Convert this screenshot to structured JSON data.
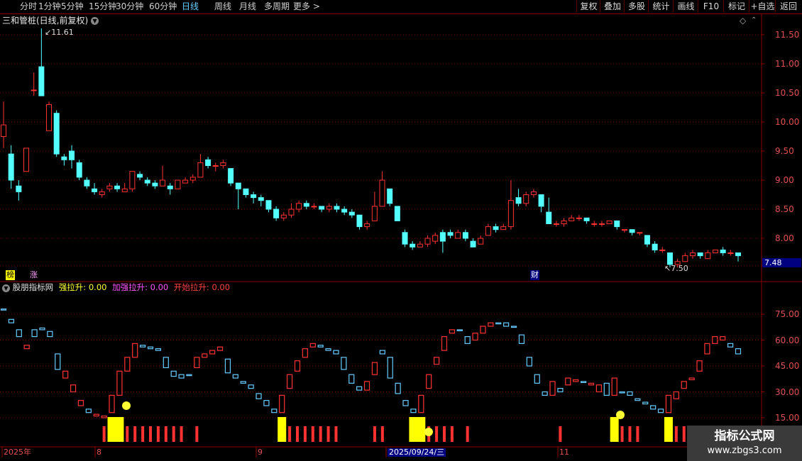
{
  "toolbar": {
    "left_items": [
      "分时",
      "1分钟",
      "5分钟",
      "15分钟",
      "30分钟",
      "60分钟",
      "日线",
      "周线",
      "月线",
      "多周期",
      "更多 >"
    ],
    "active_item": "日线",
    "right_buttons": [
      "复权",
      "叠加",
      "多股",
      "统计",
      "画线",
      "F10",
      "标记",
      "+自选",
      "返回"
    ]
  },
  "main_panel": {
    "title": "三和管桩(日线,前复权)",
    "high_label": "11.61",
    "low_label": "7.50",
    "price_tag": "7.48",
    "markers": {
      "bang": "榜",
      "zhang": "涨",
      "cai": "财"
    },
    "y_ticks": [
      "11.50",
      "11.00",
      "10.50",
      "10.00",
      "9.50",
      "9.00",
      "8.50",
      "8.00"
    ]
  },
  "indicator_panel": {
    "name": "股朋指标网",
    "line1_label": "强拉升:",
    "line1_value": "0.00",
    "line2_label": "加强拉升:",
    "line2_value": "0.00",
    "line3_label": "开始拉升:",
    "line3_value": "0.00",
    "y_ticks": [
      "75.00",
      "60.00",
      "45.00",
      "30.00",
      "15.00"
    ]
  },
  "x_axis": {
    "labels": [
      "2025年",
      "8",
      "9",
      "2025/09/24/三",
      "11"
    ]
  },
  "watermark": {
    "title": "指标公式网",
    "url": "www.zbgs3.com"
  },
  "colors": {
    "up": "#ff3232",
    "down": "#54ffff",
    "grid": "#8b0000",
    "yellow": "#ffff00",
    "magenta": "#ff55ff",
    "blue_hl": "#000080"
  },
  "chart_data": {
    "type": "candlestick",
    "candles": [
      [
        9.75,
        9.95,
        10.35,
        9.55
      ],
      [
        9.45,
        9.0,
        9.6,
        8.85
      ],
      [
        8.9,
        8.8,
        9.0,
        8.65
      ],
      [
        9.15,
        9.55,
        9.55,
        9.15
      ],
      [
        10.55,
        10.55,
        10.85,
        10.45
      ],
      [
        10.95,
        10.45,
        11.61,
        10.45
      ],
      [
        9.85,
        10.3,
        10.35,
        9.85
      ],
      [
        10.15,
        9.45,
        10.2,
        9.4
      ],
      [
        9.4,
        9.35,
        9.45,
        9.25
      ],
      [
        9.5,
        9.35,
        9.6,
        9.2
      ],
      [
        9.3,
        9.05,
        9.35,
        9.0
      ],
      [
        9.0,
        8.9,
        9.05,
        8.85
      ],
      [
        8.85,
        8.8,
        8.95,
        8.75
      ],
      [
        8.75,
        8.8,
        8.85,
        8.7
      ],
      [
        8.85,
        8.9,
        8.95,
        8.8
      ],
      [
        8.9,
        8.85,
        8.95,
        8.8
      ],
      [
        8.8,
        8.85,
        8.95,
        8.8
      ],
      [
        8.85,
        9.15,
        9.15,
        8.8
      ],
      [
        9.1,
        9.05,
        9.15,
        9.0
      ],
      [
        9.0,
        8.95,
        9.05,
        8.9
      ],
      [
        8.95,
        8.9,
        9.0,
        8.85
      ],
      [
        8.9,
        9.0,
        9.25,
        8.9
      ],
      [
        8.9,
        8.85,
        8.95,
        8.75
      ],
      [
        8.85,
        9.0,
        9.0,
        8.85
      ],
      [
        8.95,
        9.0,
        9.05,
        8.95
      ],
      [
        9.0,
        9.05,
        9.1,
        8.95
      ],
      [
        9.05,
        9.3,
        9.45,
        9.05
      ],
      [
        9.35,
        9.25,
        9.4,
        9.2
      ],
      [
        9.25,
        9.25,
        9.3,
        9.15
      ],
      [
        9.25,
        9.3,
        9.35,
        9.2
      ],
      [
        9.2,
        8.95,
        9.2,
        8.9
      ],
      [
        8.95,
        8.85,
        8.95,
        8.5
      ],
      [
        8.85,
        8.75,
        8.85,
        8.7
      ],
      [
        8.75,
        8.7,
        8.8,
        8.6
      ],
      [
        8.7,
        8.65,
        8.75,
        8.55
      ],
      [
        8.65,
        8.5,
        8.65,
        8.45
      ],
      [
        8.5,
        8.35,
        8.55,
        8.3
      ],
      [
        8.35,
        8.4,
        8.45,
        8.3
      ],
      [
        8.4,
        8.5,
        8.6,
        8.35
      ],
      [
        8.5,
        8.6,
        8.65,
        8.45
      ],
      [
        8.6,
        8.55,
        8.65,
        8.5
      ],
      [
        8.55,
        8.55,
        8.6,
        8.5
      ],
      [
        8.55,
        8.5,
        8.55,
        8.45
      ],
      [
        8.5,
        8.55,
        8.6,
        8.45
      ],
      [
        8.55,
        8.5,
        8.6,
        8.45
      ],
      [
        8.5,
        8.45,
        8.55,
        8.4
      ],
      [
        8.45,
        8.4,
        8.5,
        8.35
      ],
      [
        8.4,
        8.2,
        8.4,
        8.15
      ],
      [
        8.2,
        8.25,
        8.3,
        8.15
      ],
      [
        8.3,
        8.55,
        8.8,
        8.3
      ],
      [
        8.55,
        9.0,
        9.15,
        8.55
      ],
      [
        8.85,
        8.6,
        8.85,
        8.55
      ],
      [
        8.55,
        8.3,
        8.55,
        8.3
      ],
      [
        8.1,
        7.9,
        8.15,
        7.85
      ],
      [
        7.9,
        7.85,
        7.95,
        7.8
      ],
      [
        7.85,
        7.9,
        7.95,
        7.85
      ],
      [
        7.9,
        8.0,
        8.05,
        7.85
      ],
      [
        7.95,
        8.05,
        8.1,
        7.9
      ],
      [
        8.1,
        7.95,
        8.15,
        7.75
      ],
      [
        8.1,
        8.05,
        8.15,
        8.0
      ],
      [
        8.0,
        8.1,
        8.15,
        8.0
      ],
      [
        8.1,
        8.0,
        8.15,
        7.95
      ],
      [
        7.95,
        7.85,
        8.0,
        7.85
      ],
      [
        7.9,
        8.0,
        8.05,
        7.9
      ],
      [
        8.05,
        8.2,
        8.25,
        8.05
      ],
      [
        8.2,
        8.15,
        8.25,
        8.1
      ],
      [
        8.15,
        8.2,
        8.25,
        8.15
      ],
      [
        8.2,
        8.65,
        9.0,
        8.15
      ],
      [
        8.7,
        8.6,
        8.85,
        8.55
      ],
      [
        8.6,
        8.75,
        8.8,
        8.55
      ],
      [
        8.75,
        8.8,
        8.85,
        8.7
      ],
      [
        8.75,
        8.55,
        8.75,
        8.45
      ],
      [
        8.45,
        8.25,
        8.7,
        8.25
      ],
      [
        8.25,
        8.25,
        8.3,
        8.2
      ],
      [
        8.25,
        8.3,
        8.35,
        8.2
      ],
      [
        8.3,
        8.35,
        8.4,
        8.3
      ],
      [
        8.35,
        8.35,
        8.4,
        8.3
      ],
      [
        8.35,
        8.3,
        8.35,
        8.25
      ],
      [
        8.25,
        8.25,
        8.3,
        8.2
      ],
      [
        8.25,
        8.25,
        8.3,
        8.2
      ],
      [
        8.25,
        8.3,
        8.3,
        8.25
      ],
      [
        8.3,
        8.2,
        8.3,
        8.15
      ],
      [
        8.15,
        8.15,
        8.15,
        8.1
      ],
      [
        8.15,
        8.1,
        8.15,
        8.05
      ],
      [
        8.1,
        8.1,
        8.1,
        8.05
      ],
      [
        8.05,
        7.9,
        8.05,
        7.85
      ],
      [
        7.9,
        7.8,
        7.95,
        7.75
      ],
      [
        7.8,
        7.8,
        7.85,
        7.75
      ],
      [
        7.75,
        7.55,
        7.75,
        7.5
      ],
      [
        7.55,
        7.6,
        7.65,
        7.5
      ],
      [
        7.6,
        7.7,
        7.75,
        7.6
      ],
      [
        7.7,
        7.75,
        7.8,
        7.65
      ],
      [
        7.75,
        7.7,
        7.75,
        7.65
      ],
      [
        7.65,
        7.75,
        7.8,
        7.65
      ],
      [
        7.75,
        7.8,
        7.8,
        7.75
      ],
      [
        7.8,
        7.75,
        7.85,
        7.7
      ],
      [
        7.75,
        7.75,
        7.8,
        7.7
      ],
      [
        7.75,
        7.7,
        7.75,
        7.6
      ]
    ],
    "indicator": [
      [
        78,
        78,
        0,
        0
      ],
      [
        72,
        70,
        0,
        0
      ],
      [
        66,
        62,
        0,
        0
      ],
      [
        55,
        57,
        0,
        0
      ],
      [
        66,
        62,
        0,
        0
      ],
      [
        67,
        66,
        0,
        0
      ],
      [
        65,
        62,
        0,
        0
      ],
      [
        52,
        43,
        0,
        0
      ],
      [
        38,
        42,
        0,
        0
      ],
      [
        30,
        34,
        0,
        0
      ],
      [
        22,
        25,
        0,
        0
      ],
      [
        20,
        18,
        0,
        0
      ],
      [
        16,
        17,
        0,
        0
      ],
      [
        15,
        16,
        1,
        0
      ],
      [
        18,
        28,
        1,
        1
      ],
      [
        28,
        42,
        1,
        1
      ],
      [
        42,
        50,
        1,
        0
      ],
      [
        50,
        58,
        1,
        0
      ],
      [
        57,
        56,
        1,
        0
      ],
      [
        56,
        55,
        1,
        0
      ],
      [
        55,
        54,
        1,
        0
      ],
      [
        50,
        44,
        1,
        0
      ],
      [
        42,
        39,
        1,
        0
      ],
      [
        40,
        38,
        1,
        0
      ],
      [
        40,
        40,
        0,
        0
      ],
      [
        44,
        50,
        1,
        0
      ],
      [
        50,
        52,
        0,
        0
      ],
      [
        52,
        54,
        0,
        0
      ],
      [
        54,
        56,
        0,
        0
      ],
      [
        49,
        41,
        0,
        0
      ],
      [
        40,
        38,
        0,
        0
      ],
      [
        36,
        35,
        0,
        0
      ],
      [
        34,
        32,
        0,
        0
      ],
      [
        29,
        26,
        0,
        0
      ],
      [
        25,
        22,
        0,
        0
      ],
      [
        20,
        18,
        0,
        0
      ],
      [
        18,
        28,
        0,
        1
      ],
      [
        32,
        40,
        1,
        0
      ],
      [
        42,
        48,
        1,
        0
      ],
      [
        50,
        55,
        1,
        0
      ],
      [
        56,
        58,
        1,
        0
      ],
      [
        57,
        56,
        1,
        0
      ],
      [
        55,
        54,
        1,
        0
      ],
      [
        54,
        52,
        1,
        0
      ],
      [
        50,
        43,
        0,
        0
      ],
      [
        40,
        35,
        0,
        0
      ],
      [
        33,
        31,
        0,
        0
      ],
      [
        31,
        36,
        0,
        0
      ],
      [
        40,
        47,
        1,
        0
      ],
      [
        54,
        52,
        1,
        0
      ],
      [
        50,
        38,
        0,
        0
      ],
      [
        35,
        29,
        0,
        0
      ],
      [
        25,
        22,
        0,
        0
      ],
      [
        20,
        18,
        0,
        1
      ],
      [
        18,
        28,
        1,
        1
      ],
      [
        32,
        40,
        1,
        0
      ],
      [
        46,
        50,
        1,
        0
      ],
      [
        54,
        62,
        1,
        0
      ],
      [
        64,
        66,
        1,
        0
      ],
      [
        66,
        66,
        0,
        0
      ],
      [
        62,
        58,
        1,
        0
      ],
      [
        60,
        64,
        0,
        0
      ],
      [
        64,
        68,
        0,
        0
      ],
      [
        68,
        70,
        0,
        0
      ],
      [
        70,
        70,
        0,
        0
      ],
      [
        70,
        68,
        0,
        0
      ],
      [
        68,
        68,
        0,
        0
      ],
      [
        63,
        58,
        0,
        0
      ],
      [
        50,
        45,
        0,
        0
      ],
      [
        40,
        35,
        0,
        0
      ],
      [
        30,
        28,
        0,
        0
      ],
      [
        28,
        36,
        0,
        0
      ],
      [
        32,
        30,
        1,
        0
      ],
      [
        34,
        38,
        0,
        0
      ],
      [
        36,
        37,
        0,
        0
      ],
      [
        36,
        36,
        0,
        0
      ],
      [
        34,
        35,
        0,
        0
      ],
      [
        30,
        34,
        0,
        0
      ],
      [
        35,
        28,
        0,
        0
      ],
      [
        28,
        38,
        1,
        1
      ],
      [
        30,
        30,
        1,
        0
      ],
      [
        30,
        28,
        1,
        0
      ],
      [
        26,
        25,
        1,
        0
      ],
      [
        24,
        23,
        0,
        0
      ],
      [
        22,
        20,
        0,
        0
      ],
      [
        20,
        18,
        0,
        0
      ],
      [
        18,
        28,
        1,
        1
      ],
      [
        26,
        30,
        1,
        0
      ],
      [
        32,
        36,
        1,
        0
      ],
      [
        37,
        38,
        0,
        0
      ],
      [
        42,
        48,
        1,
        0
      ],
      [
        52,
        58,
        0,
        0
      ],
      [
        58,
        62,
        0,
        0
      ],
      [
        60,
        62,
        0,
        0
      ],
      [
        58,
        56,
        0,
        0
      ],
      [
        55,
        52,
        0,
        0
      ]
    ]
  }
}
